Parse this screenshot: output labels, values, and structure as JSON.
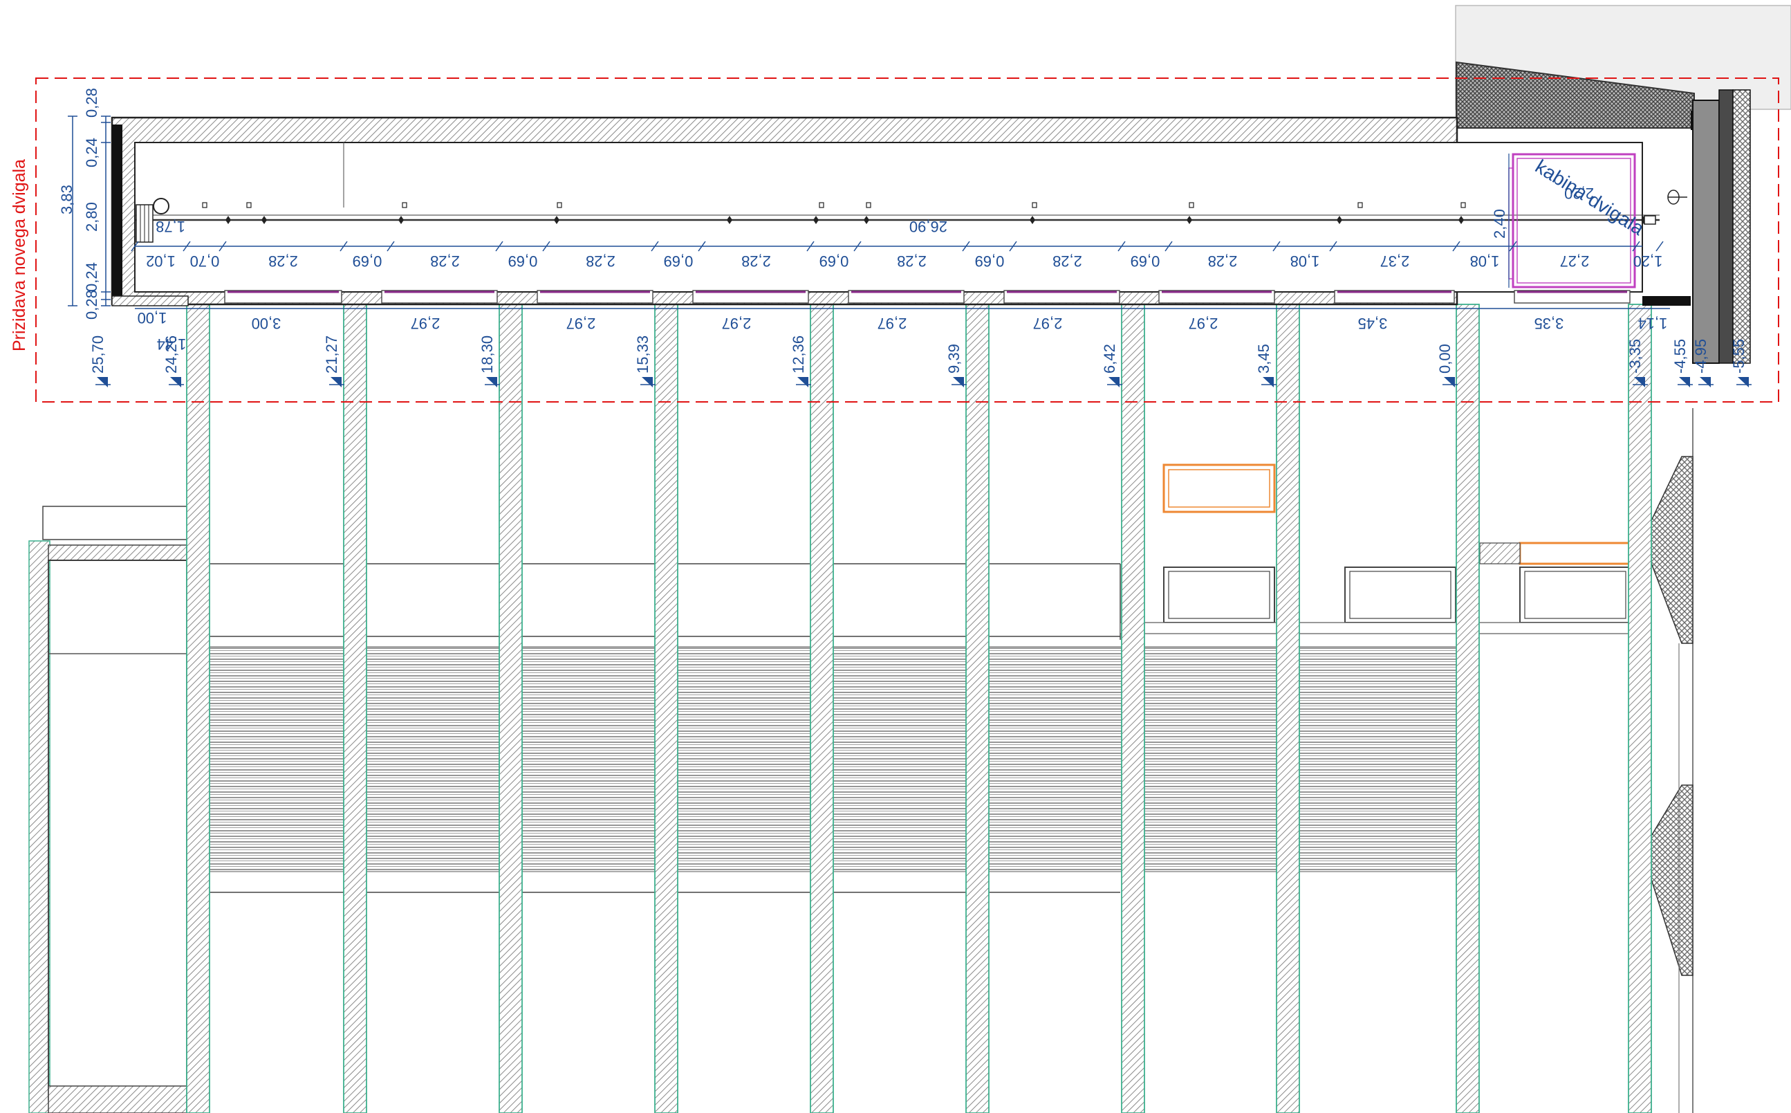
{
  "title": "Prizidava novega dvigala",
  "cabin_label": "kabina dvigala",
  "colors": {
    "dim": "#1f4e96",
    "title": "#e01414",
    "wall": "#555555",
    "hatch": "#9a9a9a",
    "column_outline": "#3db08e",
    "window": "#8a2b8a",
    "cabin": "#c040c0",
    "orange": "#ee8833"
  },
  "vertical_dims": [
    "0,28",
    "0,24",
    "2,80",
    "0,24",
    "0,28"
  ],
  "overall_height": "3,83",
  "total_length": "26,90",
  "small_dim": "1,78",
  "segment_dims": [
    "1,02",
    "0,70",
    "2,28",
    "0,69",
    "2,28",
    "0,69",
    "2,28",
    "0,69",
    "2,28",
    "0,69",
    "2,28",
    "0,69",
    "2,28",
    "0,69",
    "2,28",
    "1,08",
    "2,37",
    "1,08",
    "2,27",
    "1,20"
  ],
  "bay_dims": [
    "1,00",
    "1,44",
    "3,00",
    "2,97",
    "2,97",
    "2,97",
    "2,97",
    "2,97",
    "2,97",
    "3,45",
    "3,35",
    "1,14"
  ],
  "cabin_dims": [
    "2,20",
    "2,40"
  ],
  "levels": [
    "25,70",
    "24,26",
    "21,27",
    "18,30",
    "15,33",
    "12,36",
    "9,39",
    "6,42",
    "3,45",
    "0,00",
    "-3,35",
    "-4,55",
    "-4,95",
    "-5,55"
  ]
}
